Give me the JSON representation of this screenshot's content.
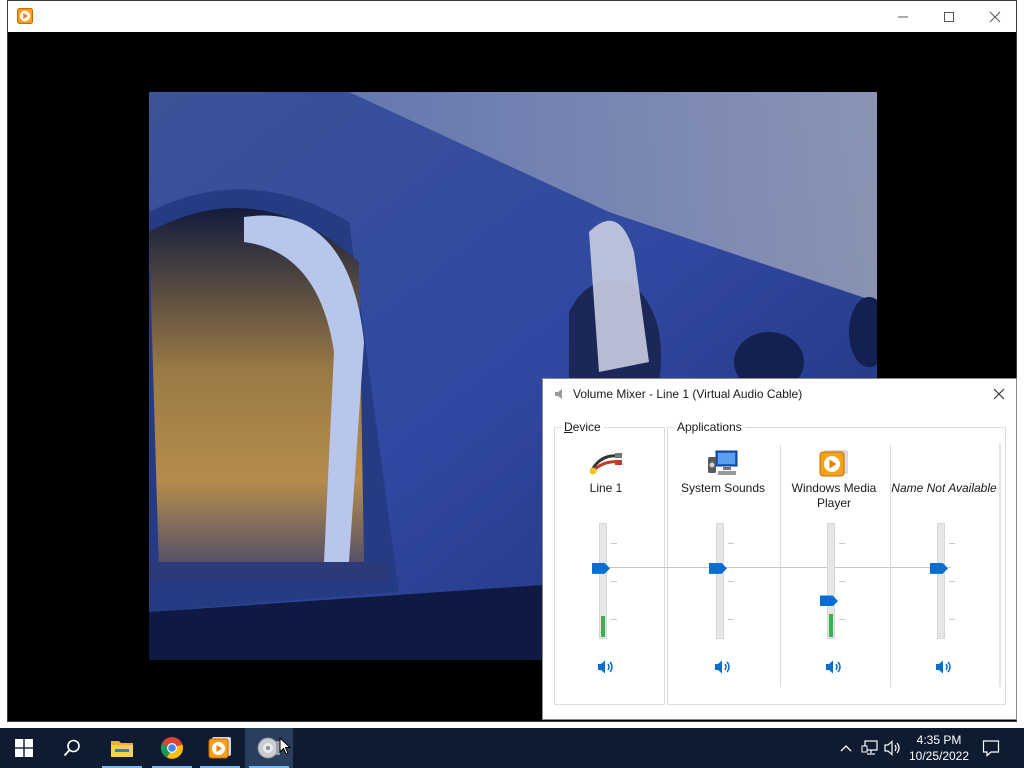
{
  "media_player": {
    "title": "",
    "window_controls": [
      "minimize",
      "maximize",
      "close"
    ],
    "app_icon": "windows-media-player-icon"
  },
  "volume_mixer": {
    "title": "Volume Mixer - Line 1 (Virtual Audio Cable)",
    "device_group": {
      "label": "Device",
      "underline": "D",
      "label_rest": "evice"
    },
    "applications_group": {
      "label": "Applications"
    },
    "channels": [
      {
        "name": "Line 1",
        "icon": "audio-cable-icon",
        "volume_percent": 62,
        "peak_percent": 18,
        "muted": false
      },
      {
        "name": "System Sounds",
        "icon": "system-sounds-icon",
        "volume_percent": 62,
        "peak_percent": 0,
        "muted": false
      },
      {
        "name": "Windows Media Player",
        "icon": "windows-media-player-icon",
        "volume_percent": 31,
        "peak_percent": 20,
        "muted": false
      },
      {
        "name": "Name Not Available",
        "icon": "",
        "volume_percent": 62,
        "peak_percent": 0,
        "muted": false,
        "italic": true
      }
    ]
  },
  "taskbar": {
    "items": [
      {
        "name": "start",
        "icon": "windows-logo-icon"
      },
      {
        "name": "search",
        "icon": "search-icon"
      },
      {
        "name": "file-explorer",
        "icon": "folder-icon",
        "running": true
      },
      {
        "name": "chrome",
        "icon": "chrome-icon",
        "running": true
      },
      {
        "name": "windows-media-player",
        "icon": "windows-media-player-icon",
        "running": true
      },
      {
        "name": "volume-mixer",
        "icon": "speaker-disc-icon",
        "running": true,
        "selected": true
      }
    ],
    "tray": {
      "icons": [
        "chevron-up-icon",
        "network-icon",
        "volume-icon"
      ],
      "time": "4:35 PM",
      "date": "10/25/2022",
      "notification_icon": "notification-icon"
    }
  },
  "colors": {
    "accent": "#0a6ed1",
    "taskbar": "#0e1b30",
    "peak_meter": "#37b24d"
  }
}
